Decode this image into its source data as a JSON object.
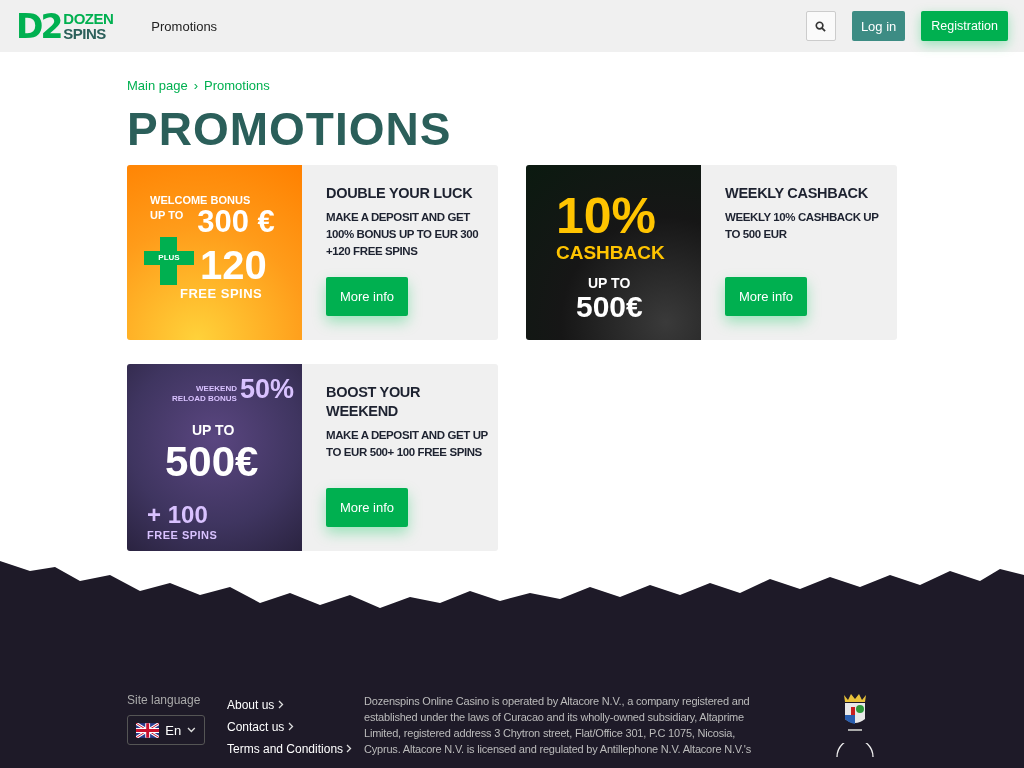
{
  "header": {
    "logo": {
      "mark": "D2",
      "line1": "DOZEN",
      "line2": "SPINS"
    },
    "nav": [
      {
        "label": "Promotions"
      }
    ],
    "login": "Log in",
    "register": "Registration"
  },
  "breadcrumbs": [
    {
      "label": "Main page"
    },
    {
      "label": "Promotions"
    }
  ],
  "breadcrumb_separator": "›",
  "title": "PROMOTIONS",
  "promotions": [
    {
      "kind": "welcome",
      "banner": [
        "WELCOME BONUS",
        "UP TO",
        "300 €",
        "PLUS",
        "120",
        "FREE SPINS"
      ],
      "title": "DOUBLE YOUR LUCK",
      "text": "MAKE A DEPOSIT AND GET 100% BONUS UP TO EUR 300 +120 FREE SPINS",
      "button": "More info"
    },
    {
      "kind": "cashback",
      "banner": [
        "10%",
        "CASHBACK",
        "UP TO",
        "500€"
      ],
      "title": "WEEKLY CASHBACK",
      "text": "WEEKLY 10% CASHBACK UP TO 500 EUR",
      "button": "More info"
    },
    {
      "kind": "reload",
      "banner": [
        "WEEKEND",
        "RELOAD BONUS",
        "50%",
        "UP TO",
        "500€",
        "+ 100",
        "FREE SPINS"
      ],
      "title": "BOOST YOUR WEEKEND",
      "text": "MAKE A DEPOSIT AND GET UP TO EUR 500+ 100 FREE SPINS",
      "button": "More info"
    }
  ],
  "footer": {
    "language_label": "Site language",
    "language": "En",
    "links": [
      {
        "label": "About us"
      },
      {
        "label": "Contact us"
      },
      {
        "label": "Terms and Conditions"
      }
    ],
    "legal": "Dozenspins Online Casino is operated by Altacore N.V., a company registered and established under the laws of Curacao and its wholly-owned subsidiary, Altaprime Limited, registered address 3 Chytron street, Flat/Office 301, P.C 1075, Nicosia, Cyprus. Altacore N.V. is licensed and regulated by Antillephone N.V. Altacore N.V.'s"
  }
}
